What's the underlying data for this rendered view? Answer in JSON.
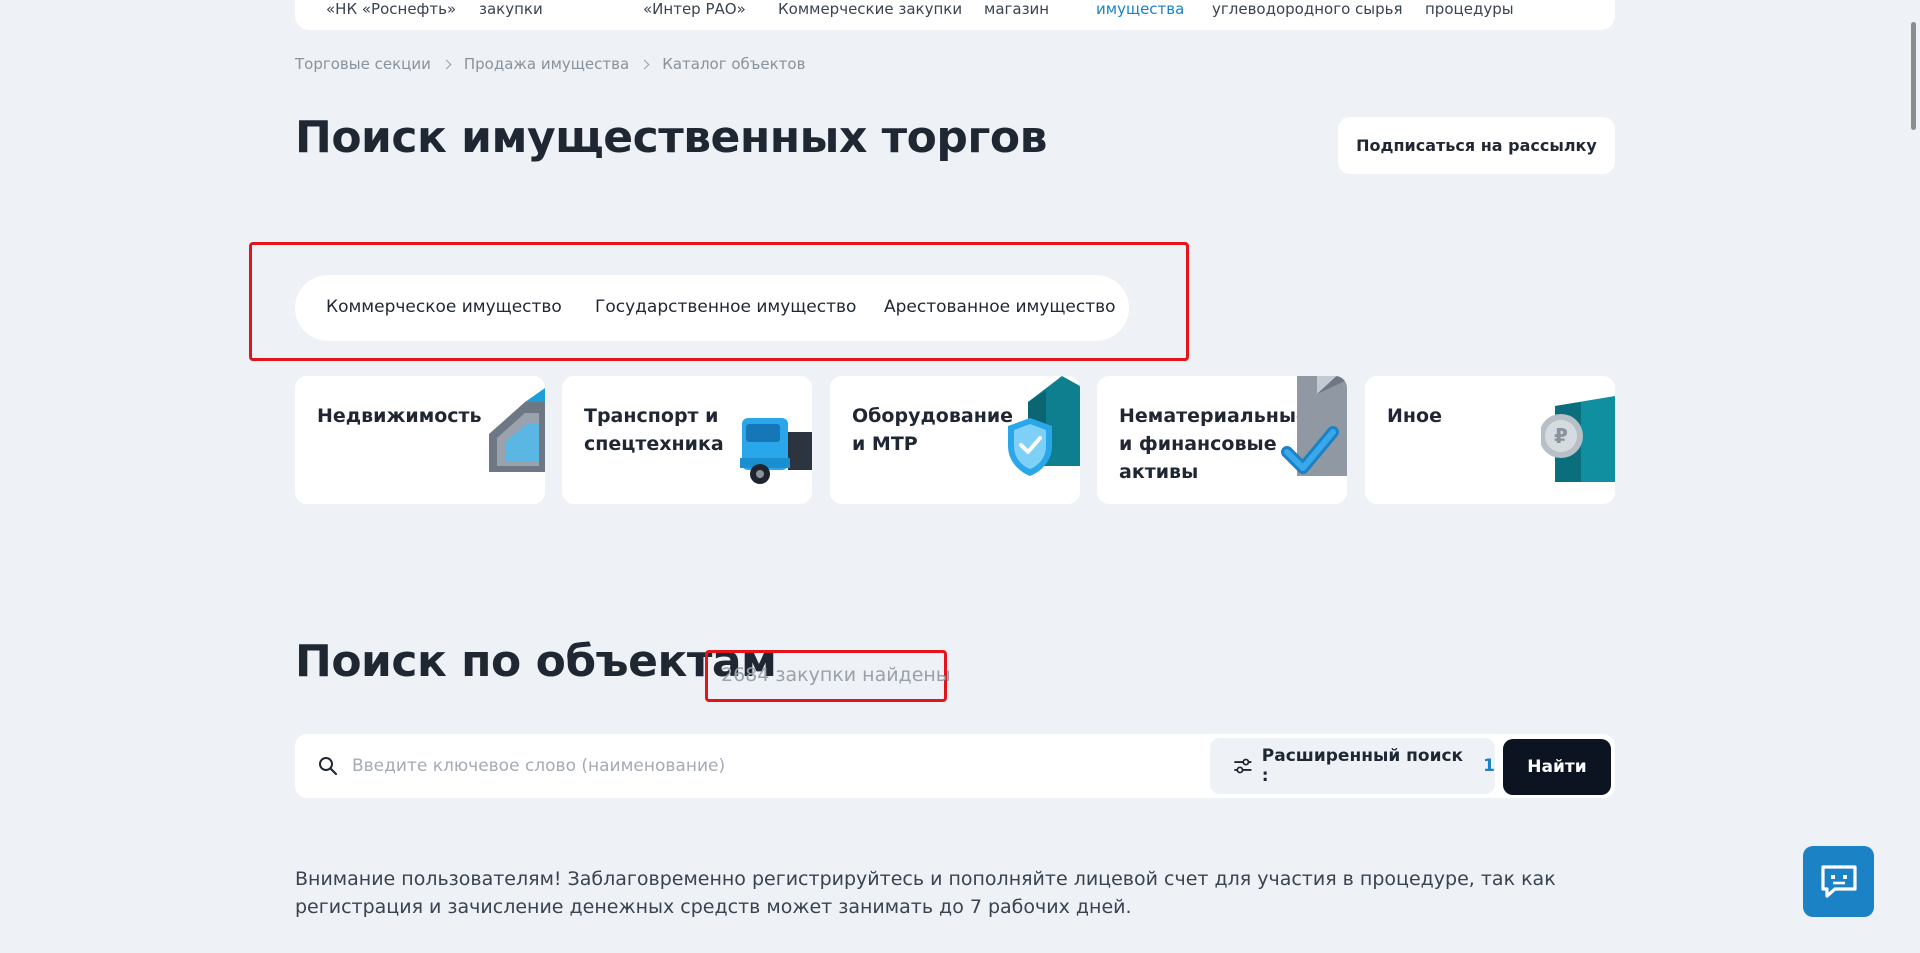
{
  "topnav": {
    "items": [
      {
        "label": "«НК «Роснефть»",
        "active": false
      },
      {
        "label": "закупки",
        "active": false
      },
      {
        "label": "«Интер РАО»",
        "active": false
      },
      {
        "label": "Коммерческие закупки",
        "active": false
      },
      {
        "label": "магазин",
        "active": false
      },
      {
        "label": "имущества",
        "active": true
      },
      {
        "label": "углеводородного сырья",
        "active": false
      },
      {
        "label": "процедуры",
        "active": false
      }
    ]
  },
  "breadcrumb": [
    "Торговые секции",
    "Продажа имущества",
    "Каталог объектов"
  ],
  "page_title": "Поиск имущественных торгов",
  "subscribe_label": "Подписаться на рассылку",
  "tabs": [
    "Коммерческое имущество",
    "Государственное имущество",
    "Арестованное имущество"
  ],
  "categories": [
    {
      "label": "Недвижимость",
      "icon": "house-icon"
    },
    {
      "label": "Транспорт и спецтехника",
      "icon": "truck-icon"
    },
    {
      "label": "Оборудование и МТР",
      "icon": "shield-check-icon"
    },
    {
      "label": "Нематериальные и финансовые активы",
      "icon": "document-check-icon"
    },
    {
      "label": "Иное",
      "icon": "coin-icon"
    }
  ],
  "objects_title": "Поиск по объектам",
  "found_count": "2684 закупки найдены",
  "search": {
    "placeholder": "Введите ключевое слово (наименование)",
    "value": "",
    "advanced_label": "Расширенный поиск :",
    "advanced_count": "1",
    "submit_label": "Найти"
  },
  "notice": "Внимание пользователям! Заблаговременно регистрируйтесь и пополняйте лицевой счет для участия в процедуре, так как регистрация и зачисление денежных средств может занимать до 7 рабочих дней.",
  "colors": {
    "accent": "#1b82c6",
    "highlight": "#e3141c",
    "dark_button": "#0b1420",
    "background": "#eef1f5"
  }
}
